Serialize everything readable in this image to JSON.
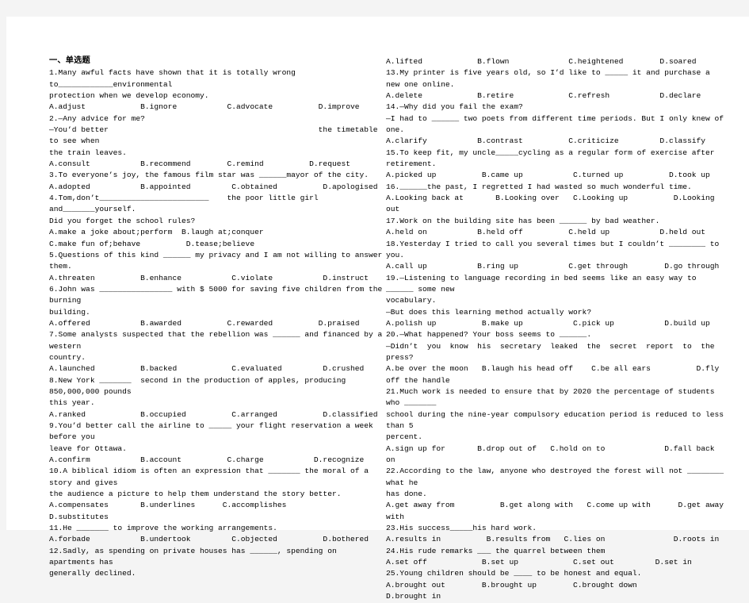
{
  "document": {
    "section_title": "一、单选题",
    "background_color": "#f4f4f4",
    "page_color": "#ffffff",
    "text_color": "#000000"
  },
  "left_column": {
    "lines": [
      "1.Many awful facts have shown that it is totally wrong to____________environmental",
      "protection when we develop economy.",
      "A.adjust            B.ignore           C.advocate          D.improve",
      "2.—Any advice for me?",
      "—You’d better                                              the timetable to see when",
      "the train leaves.",
      "A.consult           B.recommend        C.remind          D.request",
      "3.To everyone’s joy, the famous film star was ______mayor of the city.",
      "A.adopted           B.appointed         C.obtained          D.apologised",
      "4.Tom,don’t________________________    the poor little girl and_______yourself.",
      "Did you forget the school rules?",
      "A.make a joke about;perform  B.laugh at;conquer",
      "C.make fun of;behave          D.tease;believe",
      "5.Questions of this kind ______ my privacy and I am not willing to answer them.",
      "A.threaten          B.enhance           C.violate           D.instruct",
      "6.John was ________________ with $ 5000 for saving five children from the burning",
      "building.",
      "A.offered           B.awarded          C.rewarded          D.praised",
      "7.Some analysts suspected that the rebellion was ______ and financed by a western",
      "country.",
      "A.launched          B.backed            C.evaluated         D.crushed",
      "8.New York _______  second in the production of apples, producing 850,000,000 pounds",
      "this year.",
      "A.ranked            B.occupied          C.arranged          D.classified",
      "9.You’d better call the airline to _____ your flight reservation a week before you",
      "leave for Ottawa.",
      "A.confirm           B.account          C.charge           D.recognize",
      "10.A biblical idiom is often an expression that _______ the moral of a story and gives",
      "the audience a picture to help them understand the story better.",
      "A.compensates       B.underlines      C.accomplishes           D.substitutes",
      "11.He _______ to improve the working arrangements.",
      "A.forbade           B.undertook         C.objected          D.bothered",
      "12.Sadly, as spending on private houses has ______, spending on apartments has",
      "generally declined."
    ]
  },
  "right_column": {
    "lines": [
      "A.lifted            B.flown             C.heightened        D.soared",
      "13.My printer is five years old, so I’d like to _____ it and purchase a new one online.",
      "A.delete            B.retire            C.refresh           D.declare",
      "14.—Why did you fail the exam?",
      "—I had to ______ two poets from different time periods. But I only knew of one.",
      "A.clarify           B.contrast          C.criticize         D.classify",
      "15.To keep fit, my uncle_____cycling as a regular form of exercise after retirement.",
      "A.picked up          B.came up           C.turned up          D.took up",
      "16.______the past, I regretted I had wasted so much wonderful time.",
      "A.Looking back at       B.Looking over   C.Looking up          D.Looking out",
      "17.Work on the building site has been ______ by bad weather.",
      "A.held on           B.held off          C.held up           D.held out",
      "18.Yesterday I tried to call you several times but I couldn’t ________ to you.",
      "A.call up           B.ring up           C.get through        D.go through",
      "19.—Listening to language recording in bed seems like an easy way to ______ some new",
      "vocabulary.",
      "—But does this learning method actually work?",
      "A.polish up          B.make up           C.pick up           D.build up",
      "20.—What happened? Your boss seems to ______.",
      "—Didn’t  you  know  his  secretary  leaked  the  secret  report  to  the  press?",
      "A.be over the moon   B.laugh his head off    C.be all ears          D.fly off the handle",
      "21.Much work is needed to ensure that by 2020 the percentage of students who _______",
      "school during the nine-year compulsory education period is reduced to less than 5",
      "percent.",
      "A.sign up for       B.drop out of   C.hold on to             D.fall back on",
      "22.According to the law, anyone who destroyed the forest will not ________ what he",
      "has done.",
      "A.get away from          B.get along with   C.come up with      D.get away with",
      "23.His success_____his hard work.",
      "A.results in          B.results from   C.lies on               D.roots in",
      "24.His rude remarks ___ the quarrel between them",
      "A.set off            B.set up            C.set out         D.set in",
      "25.Young children should be ____ to be honest and equal.",
      "A.brought out        B.brought up        C.brought down             D.brought in"
    ]
  }
}
